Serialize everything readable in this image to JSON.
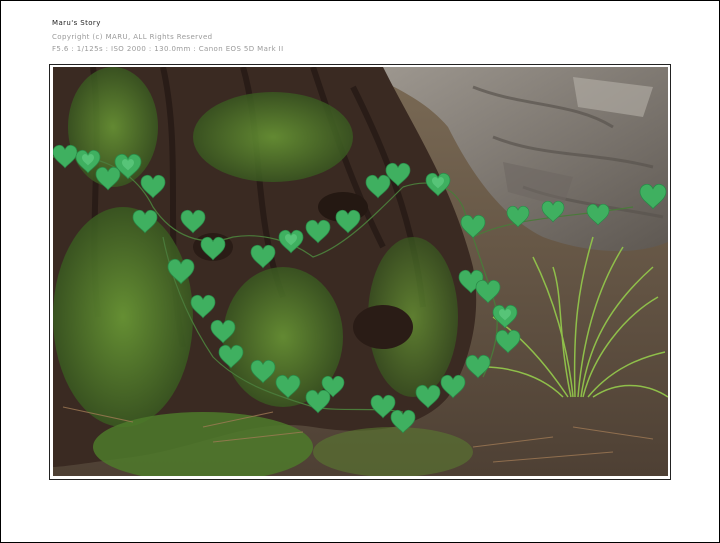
{
  "caption": {
    "title": "Maru's Story",
    "copyright": "Copyright (c) MARU, ALL Rights Reserved",
    "exif": "F5.6 : 1/125s : ISO 2000 : 130.0mm : Canon EOS 5D Mark II"
  },
  "photo": {
    "subject": "heart-shaped ivy leaves climbing a mossy tree trunk beside grass",
    "colors": {
      "moss": "#4f7a2a",
      "bark": "#3a2a22",
      "rock": "#8a8580",
      "leaf": "#3fb060",
      "leaf_light": "#6fd890",
      "grass": "#8fbf4a",
      "ground": "#6b5a48"
    }
  }
}
